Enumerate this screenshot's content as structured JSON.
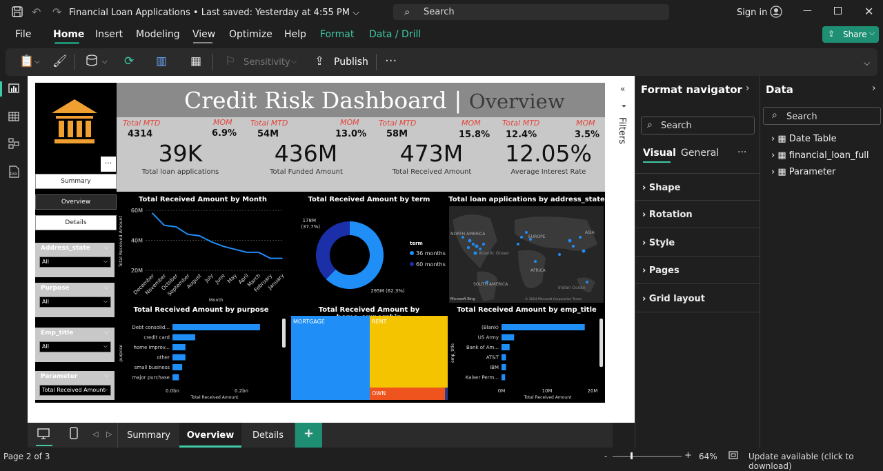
{
  "app": {
    "title": "Financial Loan Applications",
    "saved": "Last saved: Yesterday at 4:55 PM",
    "search_placeholder": "Search",
    "sign_in": "Sign in"
  },
  "menu": {
    "file": "File",
    "home": "Home",
    "insert": "Insert",
    "modeling": "Modeling",
    "view": "View",
    "optimize": "Optimize",
    "help": "Help",
    "format": "Format",
    "data_drill": "Data / Drill",
    "share": "Share"
  },
  "ribbon": {
    "sensitivity": "Sensitivity",
    "publish": "Publish",
    "more": "···"
  },
  "report": {
    "title_main": "Credit Risk Dashboard",
    "title_sep": "|",
    "title_sub": "Overview",
    "kpis": [
      {
        "mtd_label": "Total MTD",
        "mtd": "4314",
        "mom_label": "MOM",
        "mom": "6.9%",
        "value": "39K",
        "caption": "Total loan applications"
      },
      {
        "mtd_label": "Total MTD",
        "mtd": "54M",
        "mom_label": "MOM",
        "mom": "13.0%",
        "value": "436M",
        "caption": "Total Funded Amount"
      },
      {
        "mtd_label": "Total MTD",
        "mtd": "58M",
        "mom_label": "MOM",
        "mom": "15.8%",
        "value": "473M",
        "caption": "Total Received Amount"
      },
      {
        "mtd_label": "Total MTD",
        "mtd": "12.4%",
        "mom_label": "MOM",
        "mom": "3.5%",
        "value": "12.05%",
        "caption": "Average Interest Rate"
      }
    ],
    "nav_buttons": {
      "summary": "Summary",
      "overview": "Overview",
      "details": "Details",
      "more": "···"
    },
    "slicers": [
      {
        "title": "Address_state",
        "value": "All"
      },
      {
        "title": "Purpose",
        "value": "All"
      },
      {
        "title": "Emp_title",
        "value": "All"
      },
      {
        "title": "Parameter",
        "value": "Total Received Amount"
      }
    ],
    "map": {
      "title": "Total loan applications by address_state",
      "labels": [
        "NORTH AMERICA",
        "EUROPE",
        "ASIA",
        "Atlantic Ocean",
        "AFRICA",
        "SOUTH AMERICA",
        "Indian Ocean"
      ],
      "credit": "Microsoft Bing",
      "copyright": "© 2024 Microsoft Corporation Terms"
    },
    "treemap": {
      "title": "Total Received Amount by home_ownership",
      "mortgage": "MORTGAGE",
      "rent": "RENT",
      "own": "OWN"
    }
  },
  "chart_data": [
    {
      "type": "line",
      "title": "Total Received Amount by Month",
      "xlabel": "Month",
      "ylabel": "Total Received Amount",
      "categories": [
        "December",
        "November",
        "October",
        "September",
        "August",
        "July",
        "June",
        "May",
        "April",
        "March",
        "February",
        "January"
      ],
      "values": [
        58,
        50,
        49,
        44,
        43,
        39,
        36,
        34,
        32,
        32,
        28,
        28
      ],
      "yticks": [
        "60M",
        "40M",
        "20M"
      ],
      "ylim": [
        20,
        60
      ]
    },
    {
      "type": "pie",
      "title": "Total Received Amount by term",
      "legend_title": "term",
      "labels": [
        "36 months",
        "60 months"
      ],
      "values": [
        295,
        178
      ],
      "data_labels": [
        "295M (62.3%)",
        "178M (37.7%)"
      ],
      "colors": [
        "#1f8ef7",
        "#1a2fa8"
      ]
    },
    {
      "type": "bar",
      "title": "Total Received Amount by purpose",
      "xlabel": "Total Received Amount",
      "ylabel": "purpose",
      "categories": [
        "Debt consolid...",
        "credit card",
        "home improv...",
        "other",
        "small business",
        "major purchase"
      ],
      "values": [
        0.27,
        0.07,
        0.04,
        0.04,
        0.03,
        0.02
      ],
      "xticks": [
        "0.0bn",
        "0.2bn"
      ],
      "xlim": [
        0,
        0.3
      ]
    },
    {
      "type": "bar",
      "title": "Total Received Amount by emp_title",
      "xlabel": "Total Received Amount",
      "ylabel": "emp_title",
      "categories": [
        "(Blank)",
        "US Army",
        "Bank of Am...",
        "AT&T",
        "IBM",
        "Kaiser Perm..."
      ],
      "values": [
        18.5,
        2.8,
        1.8,
        1.0,
        1.0,
        0.8
      ],
      "xticks": [
        "0M",
        "10M",
        "20M"
      ],
      "xlim": [
        0,
        21
      ]
    }
  ],
  "filters_label": "Filters",
  "format_pane": {
    "title": "Format navigator",
    "search": "Search",
    "tabs": {
      "visual": "Visual",
      "general": "General",
      "more": "···"
    },
    "sections": [
      "Shape",
      "Rotation",
      "Style",
      "Pages",
      "Grid layout"
    ]
  },
  "data_pane": {
    "title": "Data",
    "search": "Search",
    "tables": [
      "Date Table",
      "financial_loan_full",
      "Parameter"
    ]
  },
  "tabs": {
    "summary": "Summary",
    "overview": "Overview",
    "details": "Details",
    "add": "+"
  },
  "status": {
    "page": "Page 2 of 3",
    "zoom": "64%",
    "update": "Update available (click to download)"
  },
  "colors": {
    "accent": "#1f8ef7",
    "brand_green": "#1f8f74",
    "format_tab": "#3fc9a6",
    "title_gray": "#7a7a7a",
    "kpi_red": "#e0463c"
  }
}
